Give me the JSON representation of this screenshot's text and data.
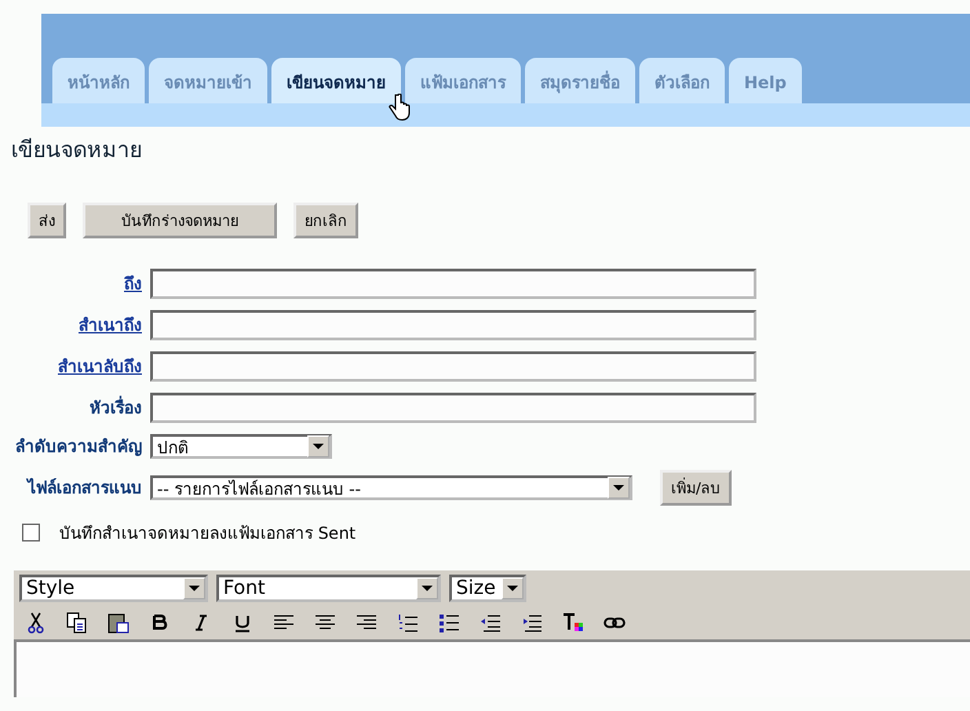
{
  "tabs": [
    {
      "label": "หน้าหลัก",
      "selected": false
    },
    {
      "label": "จดหมายเข้า",
      "selected": false
    },
    {
      "label": "เขียนจดหมาย",
      "selected": true
    },
    {
      "label": "แฟ้มเอกสาร",
      "selected": false
    },
    {
      "label": "สมุดรายชื่อ",
      "selected": false
    },
    {
      "label": "ตัวเลือก",
      "selected": false
    },
    {
      "label": "Help",
      "selected": false
    }
  ],
  "page_title": "เขียนจดหมาย",
  "action_buttons": [
    "ส่ง",
    "บันทึกร่างจดหมาย",
    "ยกเลิก"
  ],
  "fields": [
    {
      "label": "ถึง",
      "kind": "text",
      "link": true
    },
    {
      "label": "สำเนาถึง",
      "kind": "text",
      "link": true
    },
    {
      "label": "สำเนาลับถึง",
      "kind": "text",
      "link": true
    },
    {
      "label": "หัวเรื่อง",
      "kind": "text",
      "link": false
    },
    {
      "label": "ลำดับความสำคัญ",
      "kind": "select",
      "value": "ปกติ",
      "link": false
    },
    {
      "label": "ไฟล์เอกสารแนบ",
      "kind": "attach",
      "value": "-- รายการไฟล์เอกสารแนบ --",
      "button": "เพิ่ม/ลบ",
      "link": false
    }
  ],
  "save_copy": {
    "label": "บันทึกสำเนาจดหมายลงแฟ้มเอกสาร Sent",
    "checked": false
  },
  "editor": {
    "selects": [
      {
        "value": "Style",
        "kind": "wide"
      },
      {
        "value": "Font",
        "kind": "wide"
      },
      {
        "value": "Size",
        "kind": "narrow"
      }
    ]
  }
}
